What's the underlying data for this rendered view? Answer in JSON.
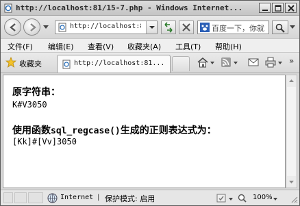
{
  "window": {
    "title": "http://localhost:81/15-7.php - Windows Internet..."
  },
  "toolbar": {
    "address": "http://localhost:8",
    "search_placeholder": "百度一下，你就"
  },
  "menu": {
    "items": [
      {
        "label": "文件(F)"
      },
      {
        "label": "编辑(E)"
      },
      {
        "label": "查看(V)"
      },
      {
        "label": "收藏夹(A)"
      },
      {
        "label": "工具(T)"
      },
      {
        "label": "帮助(H)"
      }
    ]
  },
  "favorites": {
    "label": "收藏夹",
    "tab_title": "http://localhost:81..."
  },
  "page": {
    "label1": "原字符串：",
    "value1": "K#V3050",
    "label2_prefix": "使用函数",
    "label2_code": "sql_regcase()",
    "label2_suffix": "生成的正则表达式为：",
    "value2": "[Kk]#[Vv]3050"
  },
  "status": {
    "zone": "Internet",
    "separator": "|",
    "protected_mode": "保护模式: 启用",
    "zoom": "100%"
  },
  "icons": {
    "page": "ie-page-icon",
    "back": "back-arrow-icon",
    "forward": "forward-arrow-icon",
    "refresh": "refresh-icon",
    "stop": "stop-icon",
    "search": "magnifier-icon",
    "favorites": "star-icon",
    "home": "home-icon",
    "feeds": "rss-icon",
    "mail": "mail-icon",
    "print": "printer-icon",
    "globe": "globe-icon"
  }
}
